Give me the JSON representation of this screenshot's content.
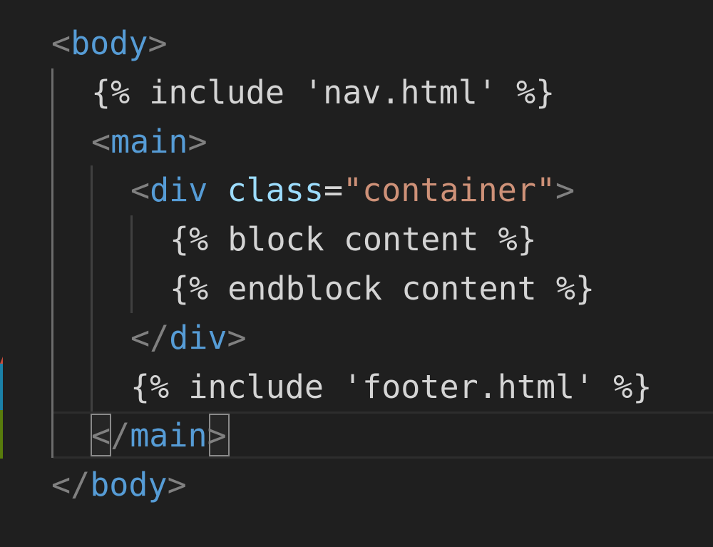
{
  "colors": {
    "background": "#1f1f1f",
    "punctuation": "#808080",
    "tag": "#569cd6",
    "attribute": "#9cdcfe",
    "string": "#ce9178",
    "text": "#d4d4d4"
  },
  "code": {
    "line1": {
      "open": "<",
      "tag": "body",
      "close": ">"
    },
    "line2": {
      "text": "{% include 'nav.html' %}"
    },
    "line3": {
      "open": "<",
      "tag": "main",
      "close": ">"
    },
    "line4": {
      "open": "<",
      "tag": "div",
      "space": " ",
      "attr": "class",
      "eq": "=",
      "value": "\"container\"",
      "close": ">"
    },
    "line5": {
      "text": "{% block content %}"
    },
    "line6": {
      "text": "{% endblock content %}"
    },
    "line7": {
      "open": "</",
      "tag": "div",
      "close": ">"
    },
    "line8": {
      "text": "{% include 'footer.html' %}"
    },
    "line9": {
      "open_lt": "<",
      "open_slash": "/",
      "tag": "main",
      "close": ">"
    },
    "line10": {
      "open": "</",
      "tag": "body",
      "close": ">"
    }
  }
}
